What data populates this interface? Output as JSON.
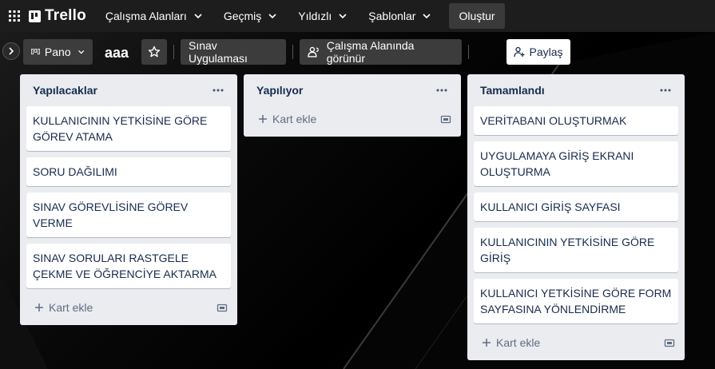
{
  "topbar": {
    "logo": "Trello",
    "nav": [
      {
        "label": "Çalışma Alanları"
      },
      {
        "label": "Geçmiş"
      },
      {
        "label": "Yıldızlı"
      },
      {
        "label": "Şablonlar"
      }
    ],
    "create_label": "Oluştur"
  },
  "board": {
    "view_label": "Pano",
    "title": "aaa",
    "workspace_label": "Sınav Uygulaması",
    "visibility_label": "Çalışma Alanında görünür",
    "share_label": "Paylaş"
  },
  "lists": [
    {
      "title": "Yapılacaklar",
      "cards": [
        "KULLANICININ YETKİSİNE GÖRE GÖREV ATAMA",
        "SORU DAĞILIMI",
        "SINAV GÖREVLİSİNE GÖREV VERME",
        "SINAV SORULARI RASTGELE ÇEKME VE ÖĞRENCİYE AKTARMA"
      ],
      "add_label": "Kart ekle"
    },
    {
      "title": "Yapılıyor",
      "cards": [],
      "add_label": "Kart ekle"
    },
    {
      "title": "Tamamlandı",
      "cards": [
        "VERİTABANI OLUŞTURMAK",
        "UYGULAMAYA GİRİŞ EKRANI OLUŞTURMA",
        "KULLANICI GİRİŞ SAYFASI",
        "KULLANICININ YETKİSİNE GÖRE GİRİŞ",
        "KULLANICI YETKİSİNE GÖRE FORM SAYFASINA YÖNLENDİRME"
      ],
      "add_label": "Kart ekle"
    }
  ]
}
